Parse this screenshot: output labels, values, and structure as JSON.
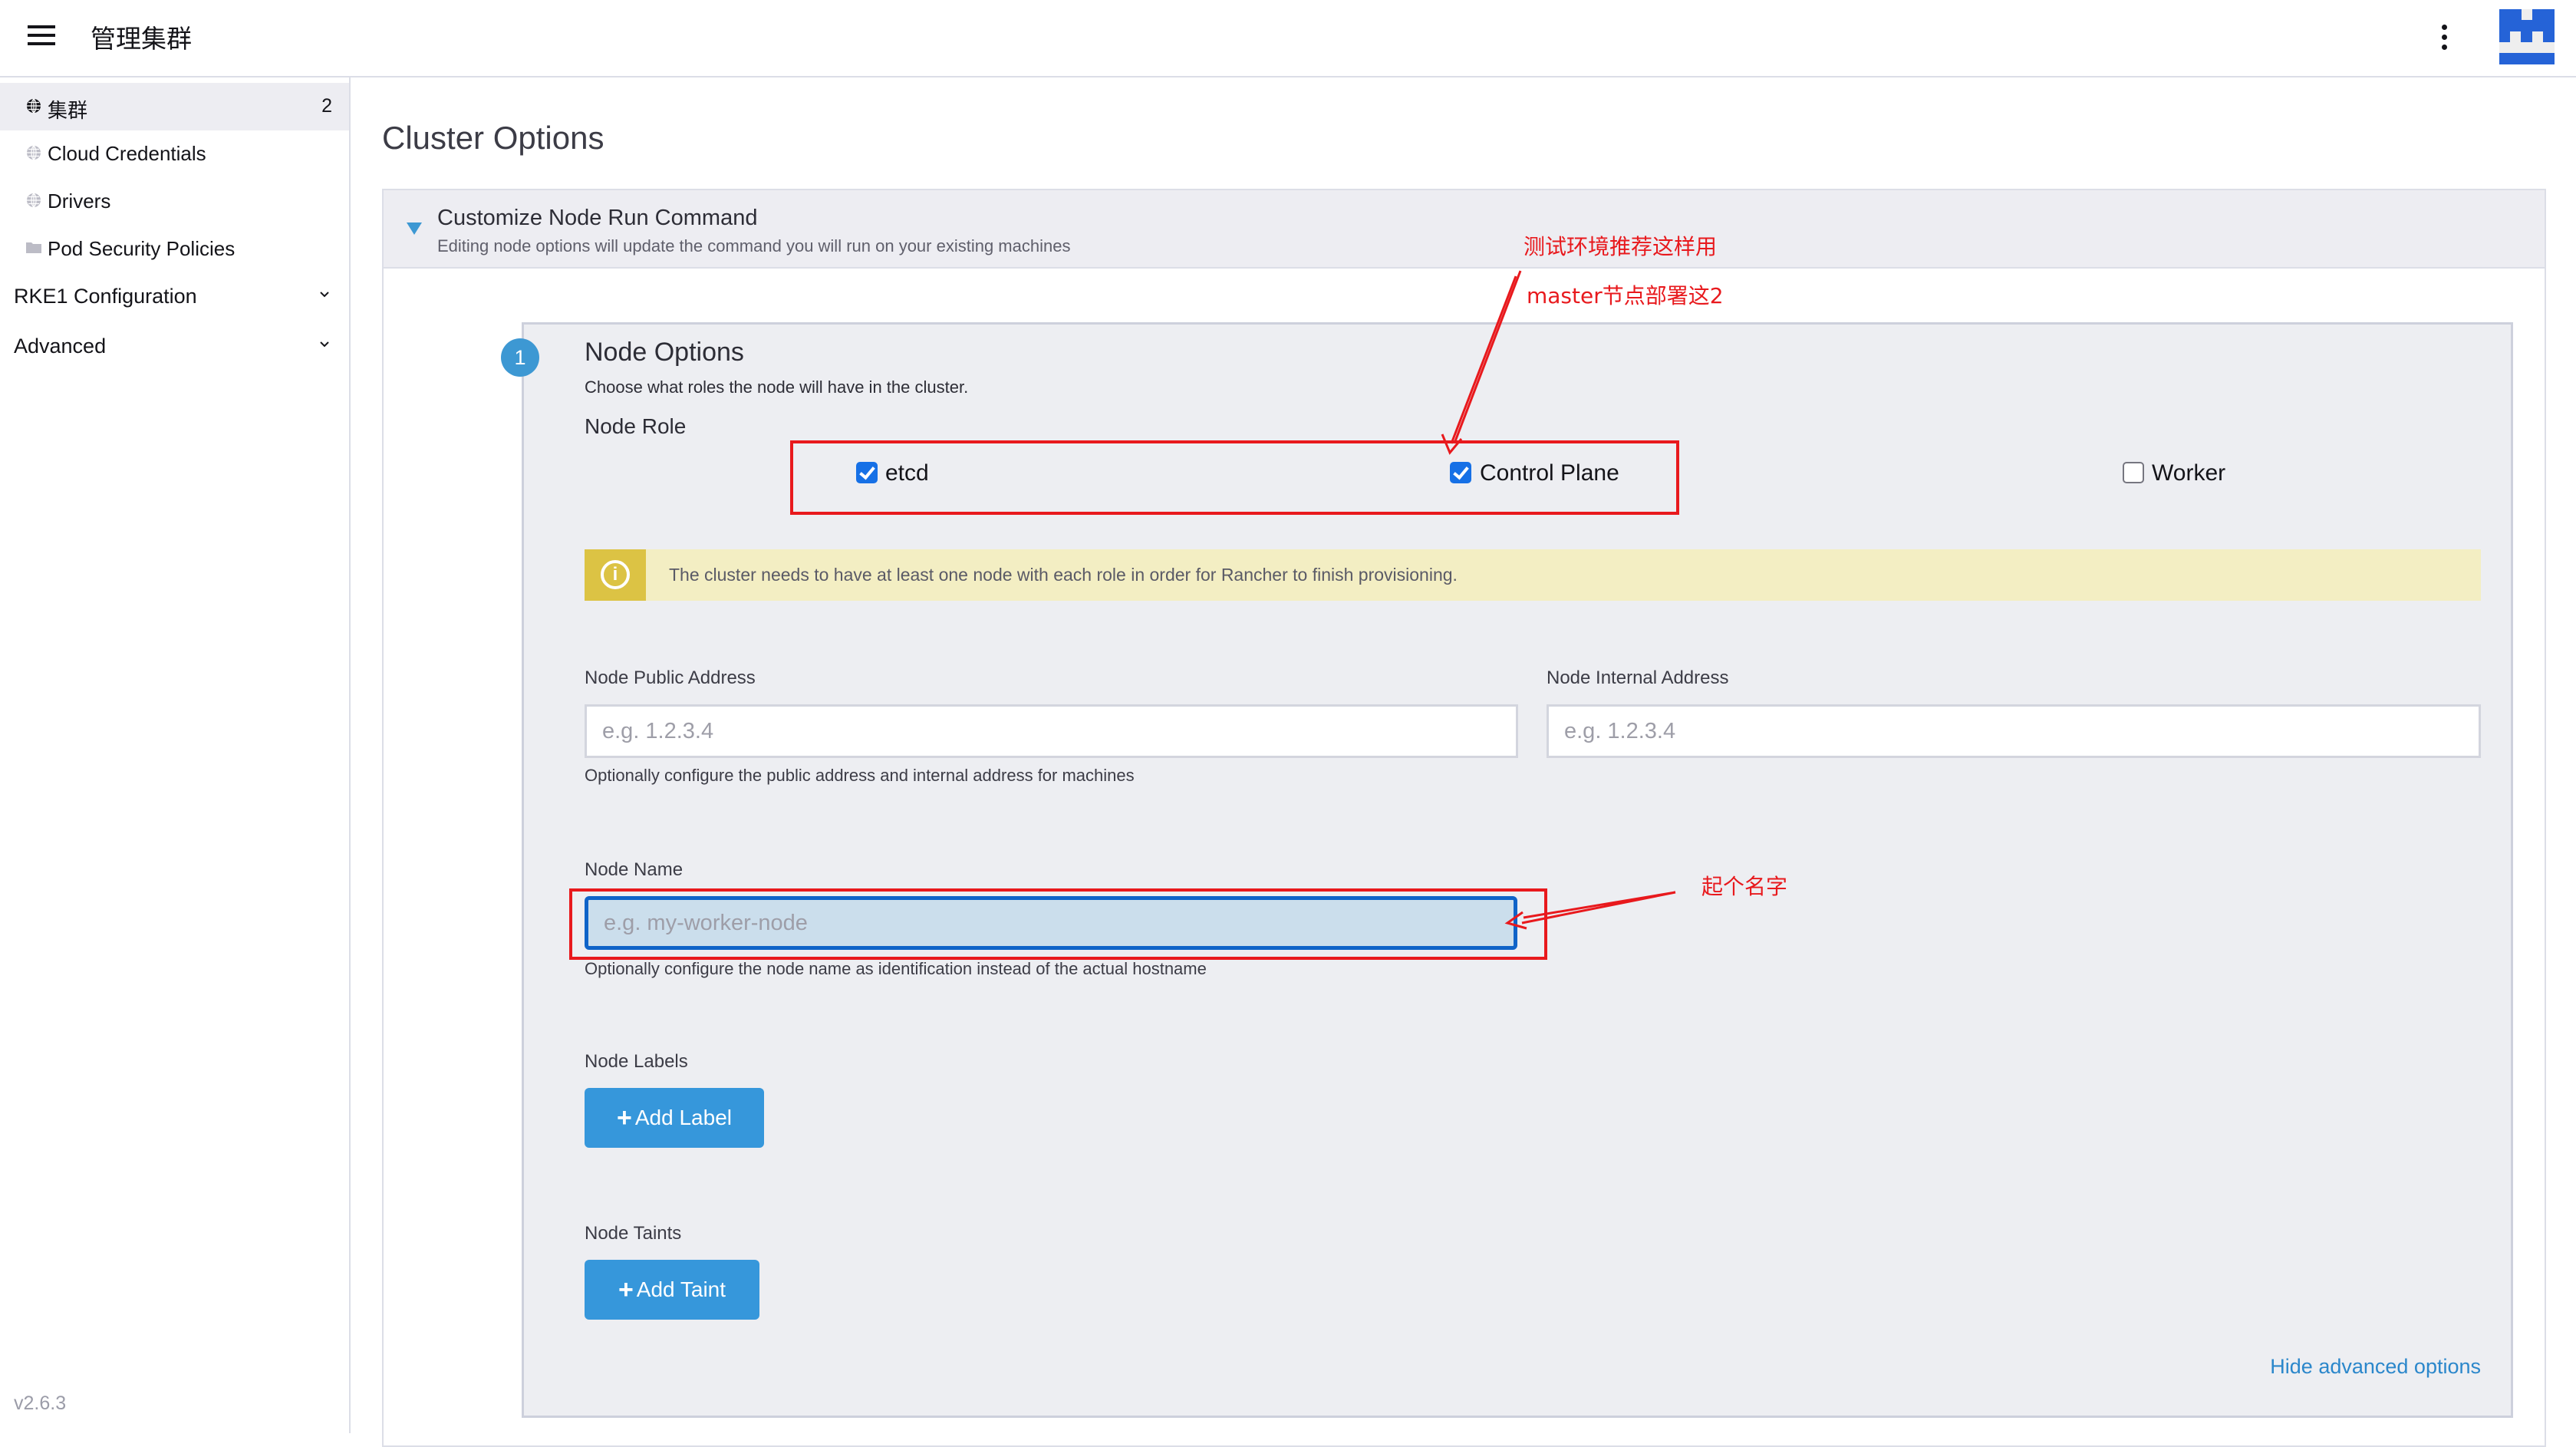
{
  "header": {
    "title": "管理集群",
    "menu_icon": "hamburger-icon",
    "more_icon": "kebab-menu-icon",
    "logo": "rancher-logo",
    "brand_color": "#2563d7"
  },
  "sidebar": {
    "items": [
      {
        "label": "集群",
        "icon": "globe-icon",
        "count": "2",
        "active": true
      },
      {
        "label": "Cloud Credentials",
        "icon": "globe-icon"
      },
      {
        "label": "Drivers",
        "icon": "globe-icon"
      },
      {
        "label": "Pod Security Policies",
        "icon": "folder-icon"
      }
    ],
    "groups": [
      {
        "label": "RKE1 Configuration",
        "icon": "chevron-down-icon"
      },
      {
        "label": "Advanced",
        "icon": "chevron-down-icon"
      }
    ],
    "version": "v2.6.3"
  },
  "main": {
    "page_title": "Cluster Options",
    "accordion": {
      "title": "Customize Node Run Command",
      "subtitle": "Editing node options will update the command you will run on your existing machines",
      "expanded": true
    },
    "node_options": {
      "step": "1",
      "title": "Node Options",
      "subtitle": "Choose what roles the node will have in the cluster.",
      "role_label": "Node Role",
      "roles": [
        {
          "label": "etcd",
          "checked": true
        },
        {
          "label": "Control Plane",
          "checked": true
        },
        {
          "label": "Worker",
          "checked": false
        }
      ],
      "warning": "The cluster needs to have at least one node with each role in order for Rancher to finish provisioning.",
      "public_address": {
        "label": "Node Public Address",
        "value": "",
        "placeholder": "e.g. 1.2.3.4"
      },
      "internal_address": {
        "label": "Node Internal Address",
        "value": "",
        "placeholder": "e.g. 1.2.3.4"
      },
      "address_hint": "Optionally configure the public address and internal address for machines",
      "node_name": {
        "label": "Node Name",
        "value": "",
        "placeholder": "e.g. my-worker-node"
      },
      "node_name_hint": "Optionally configure the node name as identification instead of the actual hostname",
      "labels_label": "Node Labels",
      "add_label_button": "Add Label",
      "taints_label": "Node Taints",
      "add_taint_button": "Add Taint",
      "hide_advanced": "Hide advanced options"
    }
  },
  "annotations": {
    "note_roles_1": "测试环境推荐这样用",
    "note_roles_2": "master节点部署这2",
    "note_name": "起个名字",
    "color": "#e8191d"
  },
  "colors": {
    "accent": "#3697db",
    "checkbox": "#1670e6",
    "warning_bg": "#f3eec3",
    "warning_icon_bg": "#dcc344",
    "panel_bg": "#edeef2"
  }
}
